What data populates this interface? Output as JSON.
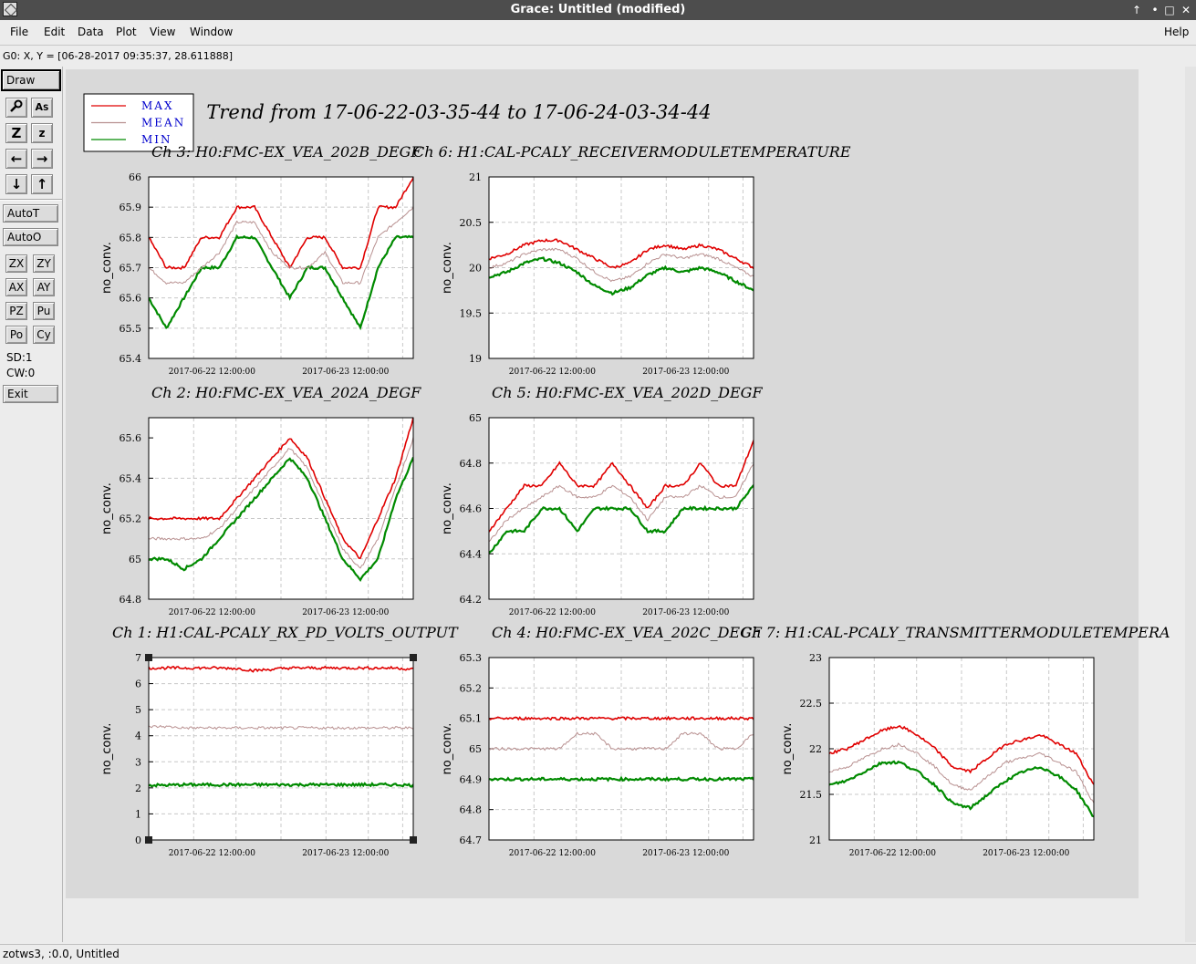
{
  "window": {
    "title": "Grace: Untitled (modified)"
  },
  "menubar": {
    "file": "File",
    "edit": "Edit",
    "data": "Data",
    "plot": "Plot",
    "view": "View",
    "window": "Window",
    "help": "Help"
  },
  "locator": "G0: X, Y = [06-28-2017 09:35:37, 28.611888]",
  "toolbar": {
    "draw": "Draw",
    "autot": "AutoT",
    "autoo": "AutoO",
    "zx": "ZX",
    "zy": "ZY",
    "ax": "AX",
    "ay": "AY",
    "pz": "PZ",
    "pu": "Pu",
    "po": "Po",
    "cy": "Cy",
    "sd": "SD:1",
    "cw": "CW:0",
    "exit": "Exit"
  },
  "status": "zotws3, :0.0, Untitled",
  "figure": {
    "title": "Trend from 17-06-22-03-35-44 to 17-06-24-03-34-44",
    "legend": [
      {
        "label": "MAX",
        "color": "#e00000"
      },
      {
        "label": "MEAN",
        "color": "#b89090"
      },
      {
        "label": "MIN",
        "color": "#008a00"
      }
    ]
  },
  "chart_data": [
    {
      "type": "line",
      "title": "Ch 3: H0:FMC-EX_VEA_202B_DEGF",
      "ylabel": "no_conv.",
      "ylim": [
        65.4,
        66.0
      ],
      "yticks": [
        "65.4",
        "65.5",
        "65.6",
        "65.7",
        "65.8",
        "65.9",
        "66"
      ],
      "xticks": [
        "2017-06-22 12:00:00",
        "2017-06-23 12:00:00"
      ],
      "series": [
        {
          "name": "MAX",
          "values": [
            65.8,
            65.7,
            65.7,
            65.8,
            65.8,
            65.9,
            65.9,
            65.8,
            65.7,
            65.8,
            65.8,
            65.7,
            65.7,
            65.9,
            65.9,
            66.0
          ]
        },
        {
          "name": "MEAN",
          "values": [
            65.7,
            65.65,
            65.65,
            65.7,
            65.75,
            65.85,
            65.85,
            65.75,
            65.7,
            65.7,
            65.75,
            65.65,
            65.65,
            65.8,
            65.85,
            65.9
          ]
        },
        {
          "name": "MIN",
          "values": [
            65.6,
            65.5,
            65.6,
            65.7,
            65.7,
            65.8,
            65.8,
            65.7,
            65.6,
            65.7,
            65.7,
            65.6,
            65.5,
            65.7,
            65.8,
            65.8
          ]
        }
      ]
    },
    {
      "type": "line",
      "title": "Ch 6: H1:CAL-PCALY_RECEIVERMODULETEMPERATURE",
      "ylabel": "no_conv.",
      "ylim": [
        19,
        21
      ],
      "yticks": [
        "19",
        "19.5",
        "20",
        "20.5",
        "21"
      ],
      "xticks": [
        "2017-06-22 12:00:00",
        "2017-06-23 12:00:00"
      ],
      "series": [
        {
          "name": "MAX",
          "values": [
            20.1,
            20.15,
            20.25,
            20.3,
            20.3,
            20.2,
            20.1,
            20.0,
            20.05,
            20.2,
            20.25,
            20.2,
            20.25,
            20.2,
            20.1,
            20.0
          ]
        },
        {
          "name": "MEAN",
          "values": [
            20.0,
            20.05,
            20.15,
            20.2,
            20.2,
            20.1,
            19.95,
            19.85,
            19.9,
            20.05,
            20.15,
            20.1,
            20.15,
            20.1,
            20.0,
            19.9
          ]
        },
        {
          "name": "MIN",
          "values": [
            19.9,
            19.95,
            20.05,
            20.1,
            20.05,
            19.95,
            19.8,
            19.72,
            19.78,
            19.92,
            20.0,
            19.95,
            20.0,
            19.95,
            19.85,
            19.75
          ]
        }
      ]
    },
    {
      "type": "line",
      "title": "Ch 2: H0:FMC-EX_VEA_202A_DEGF",
      "ylabel": "no_conv.",
      "ylim": [
        64.8,
        65.7
      ],
      "yticks": [
        "64.8",
        "65",
        "65.2",
        "65.4",
        "65.6"
      ],
      "xticks": [
        "2017-06-22 12:00:00",
        "2017-06-23 12:00:00"
      ],
      "series": [
        {
          "name": "MAX",
          "values": [
            65.2,
            65.2,
            65.2,
            65.2,
            65.2,
            65.3,
            65.4,
            65.5,
            65.6,
            65.5,
            65.3,
            65.1,
            65.0,
            65.2,
            65.4,
            65.7
          ]
        },
        {
          "name": "MEAN",
          "values": [
            65.1,
            65.1,
            65.1,
            65.1,
            65.15,
            65.25,
            65.35,
            65.45,
            65.55,
            65.45,
            65.25,
            65.05,
            64.95,
            65.1,
            65.35,
            65.6
          ]
        },
        {
          "name": "MIN",
          "values": [
            65.0,
            65.0,
            64.95,
            65.0,
            65.1,
            65.2,
            65.3,
            65.4,
            65.5,
            65.4,
            65.2,
            65.0,
            64.9,
            65.0,
            65.3,
            65.5
          ]
        }
      ]
    },
    {
      "type": "line",
      "title": "Ch 5: H0:FMC-EX_VEA_202D_DEGF",
      "ylabel": "no_conv.",
      "ylim": [
        64.2,
        65.0
      ],
      "yticks": [
        "64.2",
        "64.4",
        "64.6",
        "64.8",
        "65"
      ],
      "xticks": [
        "2017-06-22 12:00:00",
        "2017-06-23 12:00:00"
      ],
      "series": [
        {
          "name": "MAX",
          "values": [
            64.5,
            64.6,
            64.7,
            64.7,
            64.8,
            64.7,
            64.7,
            64.8,
            64.7,
            64.6,
            64.7,
            64.7,
            64.8,
            64.7,
            64.7,
            64.9
          ]
        },
        {
          "name": "MEAN",
          "values": [
            64.45,
            64.55,
            64.6,
            64.65,
            64.7,
            64.65,
            64.65,
            64.7,
            64.65,
            64.55,
            64.65,
            64.65,
            64.7,
            64.65,
            64.65,
            64.8
          ]
        },
        {
          "name": "MIN",
          "values": [
            64.4,
            64.5,
            64.5,
            64.6,
            64.6,
            64.5,
            64.6,
            64.6,
            64.6,
            64.5,
            64.5,
            64.6,
            64.6,
            64.6,
            64.6,
            64.7
          ]
        }
      ]
    },
    {
      "type": "line",
      "title": "Ch 1: H1:CAL-PCALY_RX_PD_VOLTS_OUTPUT",
      "ylabel": "no_conv.",
      "ylim": [
        0,
        7
      ],
      "yticks": [
        "0",
        "1",
        "2",
        "3",
        "4",
        "5",
        "6",
        "7"
      ],
      "xticks": [
        "2017-06-22 12:00:00",
        "2017-06-23 12:00:00"
      ],
      "series": [
        {
          "name": "MAX",
          "values": [
            6.6,
            6.6,
            6.6,
            6.6,
            6.6,
            6.58,
            6.5,
            6.55,
            6.6,
            6.6,
            6.6,
            6.6,
            6.6,
            6.6,
            6.6,
            6.55
          ]
        },
        {
          "name": "MEAN",
          "values": [
            4.35,
            4.35,
            4.3,
            4.3,
            4.3,
            4.3,
            4.3,
            4.3,
            4.3,
            4.3,
            4.3,
            4.3,
            4.3,
            4.3,
            4.3,
            4.3
          ]
        },
        {
          "name": "MIN",
          "values": [
            2.1,
            2.1,
            2.12,
            2.12,
            2.12,
            2.12,
            2.12,
            2.12,
            2.12,
            2.12,
            2.12,
            2.12,
            2.12,
            2.12,
            2.12,
            2.1
          ]
        }
      ]
    },
    {
      "type": "line",
      "title": "Ch 4: H0:FMC-EX_VEA_202C_DEGF",
      "ylabel": "no_conv.",
      "ylim": [
        64.7,
        65.3
      ],
      "yticks": [
        "64.7",
        "64.8",
        "64.9",
        "65",
        "65.1",
        "65.2",
        "65.3"
      ],
      "xticks": [
        "2017-06-22 12:00:00",
        "2017-06-23 12:00:00"
      ],
      "series": [
        {
          "name": "MAX",
          "values": [
            65.1,
            65.1,
            65.1,
            65.1,
            65.1,
            65.1,
            65.1,
            65.1,
            65.1,
            65.1,
            65.1,
            65.1,
            65.1,
            65.1,
            65.1,
            65.1
          ]
        },
        {
          "name": "MEAN",
          "values": [
            65.0,
            65.0,
            65.0,
            65.0,
            65.0,
            65.05,
            65.05,
            65.0,
            65.0,
            65.0,
            65.0,
            65.05,
            65.05,
            65.0,
            65.0,
            65.05
          ]
        },
        {
          "name": "MIN",
          "values": [
            64.9,
            64.9,
            64.9,
            64.9,
            64.9,
            64.9,
            64.9,
            64.9,
            64.9,
            64.9,
            64.9,
            64.9,
            64.9,
            64.9,
            64.9,
            64.9
          ]
        }
      ]
    },
    {
      "type": "line",
      "title": "Ch 7: H1:CAL-PCALY_TRANSMITTERMODULETEMPERA",
      "ylabel": "no_conv.",
      "ylim": [
        21,
        23
      ],
      "yticks": [
        "21",
        "21.5",
        "22",
        "22.5",
        "23"
      ],
      "xticks": [
        "2017-06-22 12:00:00",
        "2017-06-23 12:00:00"
      ],
      "series": [
        {
          "name": "MAX",
          "values": [
            21.95,
            22.0,
            22.1,
            22.2,
            22.25,
            22.15,
            22.0,
            21.8,
            21.75,
            21.9,
            22.05,
            22.1,
            22.15,
            22.05,
            21.95,
            21.6
          ]
        },
        {
          "name": "MEAN",
          "values": [
            21.75,
            21.8,
            21.9,
            22.0,
            22.05,
            21.95,
            21.8,
            21.6,
            21.55,
            21.7,
            21.85,
            21.9,
            21.95,
            21.85,
            21.75,
            21.4
          ]
        },
        {
          "name": "MIN",
          "values": [
            21.6,
            21.65,
            21.75,
            21.85,
            21.85,
            21.75,
            21.6,
            21.4,
            21.35,
            21.5,
            21.65,
            21.75,
            21.8,
            21.7,
            21.55,
            21.25
          ]
        }
      ]
    }
  ]
}
